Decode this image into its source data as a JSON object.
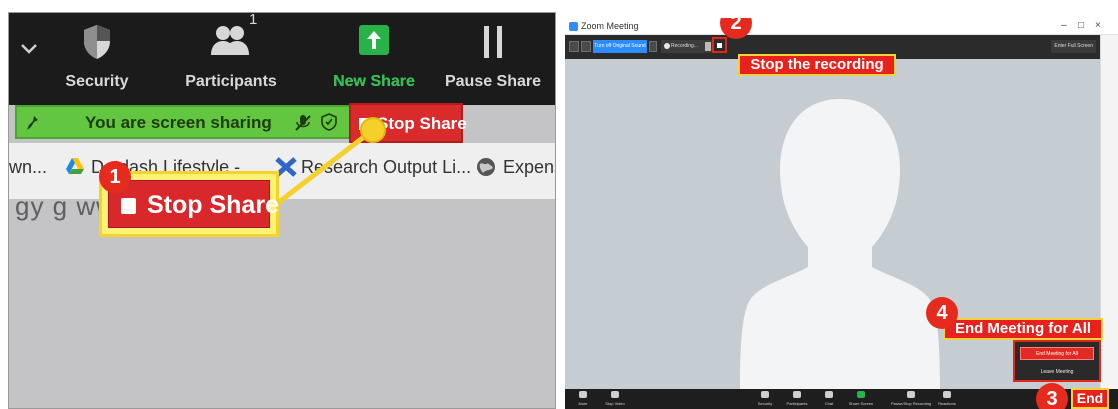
{
  "left": {
    "toolbar": {
      "security_label": "Security",
      "participants_label": "Participants",
      "participants_count": "1",
      "new_share_label": "New Share",
      "pause_share_label": "Pause Share"
    },
    "share_bar": {
      "text": "You are screen sharing"
    },
    "stop_share_small": "Stop Share",
    "bookmarks": [
      {
        "label": "wn..."
      },
      {
        "label": "Dotdash Lifestyle -..."
      },
      {
        "label": "Research Output Li..."
      },
      {
        "label": "Expenses"
      }
    ],
    "stop_share_big": "Stop Share",
    "step": "1"
  },
  "right": {
    "window_title": "Zoom Meeting",
    "window_controls": {
      "minimize": "–",
      "maximize": "□",
      "close": "×"
    },
    "topbar": {
      "original_sound": "Turn off Original Sound",
      "recording": "Recording...",
      "fullscreen": "Enter Full Screen"
    },
    "callouts": {
      "step2": "2",
      "stop_recording": "Stop the recording",
      "step4": "4",
      "end_meeting_for_all": "End Meeting for All",
      "step3": "3",
      "end": "End"
    },
    "end_menu": {
      "end_all": "End Meeting for All",
      "leave": "Leave Meeting"
    },
    "bottombar": [
      {
        "label": "Mute"
      },
      {
        "label": "Stop Video"
      },
      {
        "label": "Security"
      },
      {
        "label": "Participants"
      },
      {
        "label": "Chat"
      },
      {
        "label": "Share Screen"
      },
      {
        "label": "Pause/Stop Recording"
      },
      {
        "label": "Reactions"
      }
    ],
    "accent_colors": {
      "zoom_blue": "#2d8cff",
      "share_green": "#27b347",
      "stop_red": "#e02a23",
      "callout_red": "#e8211d",
      "highlight_yellow": "#f1d33b"
    }
  }
}
